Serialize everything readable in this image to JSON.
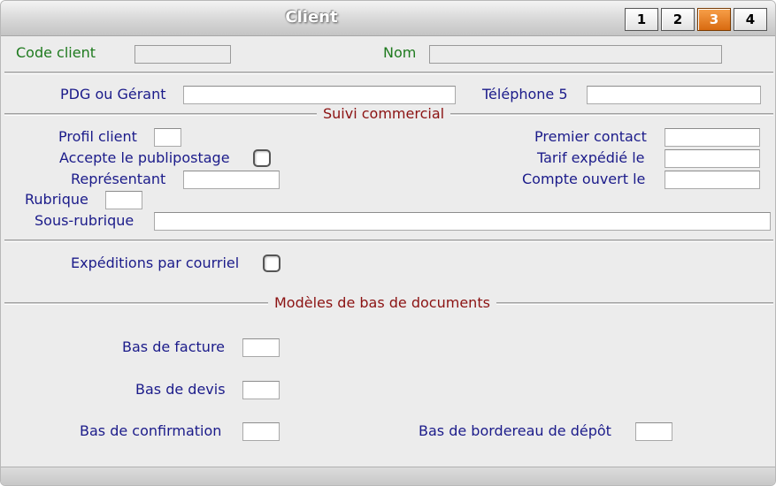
{
  "window": {
    "title": "Client"
  },
  "tabs": [
    {
      "label": "1",
      "active": false
    },
    {
      "label": "2",
      "active": false
    },
    {
      "label": "3",
      "active": true
    },
    {
      "label": "4",
      "active": false
    }
  ],
  "header": {
    "code_client_label": "Code client",
    "code_client_value": "",
    "nom_label": "Nom",
    "nom_value": ""
  },
  "general": {
    "pdg_label": "PDG ou Gérant",
    "pdg_value": "",
    "telephone5_label": "Téléphone 5",
    "telephone5_value": ""
  },
  "suivi": {
    "section_title": "Suivi commercial",
    "profil_label": "Profil client",
    "profil_value": "",
    "publipostage_label": "Accepte le publipostage",
    "publipostage_checked": false,
    "representant_label": "Représentant",
    "representant_value": "",
    "rubrique_label": "Rubrique",
    "rubrique_value": "",
    "sous_rubrique_label": "Sous-rubrique",
    "sous_rubrique_value": "",
    "premier_contact_label": "Premier contact",
    "premier_contact_value": "",
    "tarif_expedie_label": "Tarif expédié le",
    "tarif_expedie_value": "",
    "compte_ouvert_label": "Compte ouvert le",
    "compte_ouvert_value": ""
  },
  "expeditions": {
    "courriel_label": "Expéditions par courriel",
    "courriel_checked": false
  },
  "modeles": {
    "section_title": "Modèles de bas de documents",
    "facture_label": "Bas de facture",
    "facture_value": "",
    "devis_label": "Bas de devis",
    "devis_value": "",
    "confirmation_label": "Bas de confirmation",
    "confirmation_value": "",
    "bordereau_label": "Bas de bordereau de dépôt",
    "bordereau_value": ""
  },
  "colors": {
    "label_blue": "#1b1b8a",
    "label_green": "#1e7a1e",
    "section_red": "#8b1212",
    "active_tab": "#e07818",
    "background": "#ececec"
  }
}
